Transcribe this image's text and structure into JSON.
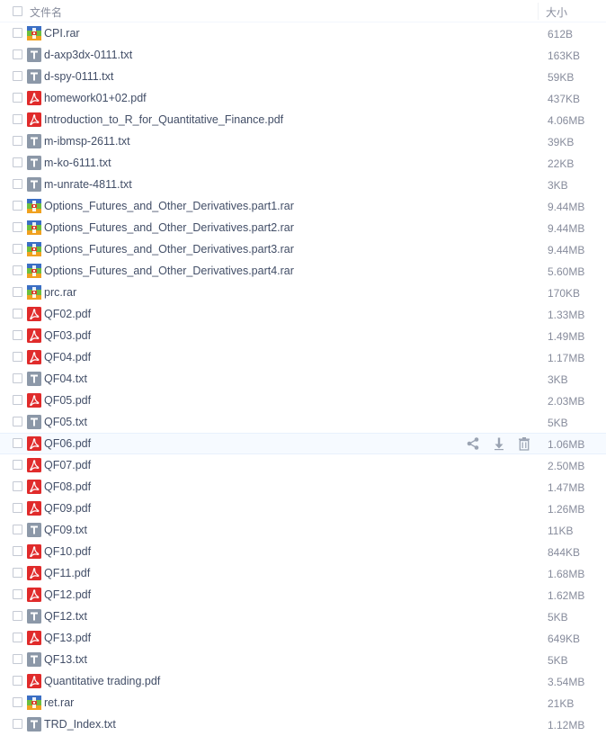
{
  "header": {
    "name_label": "文件名",
    "size_label": "大小"
  },
  "colors": {
    "text": "#424e67",
    "muted": "#878c9c",
    "hover_row": "#f6faff",
    "pdf_red": "#e02b2b",
    "txt_gray": "#8c98a8",
    "rar_blue": "#3b6fc4",
    "rar_green": "#6cbf3e",
    "rar_orange": "#f0a11f",
    "action_icon": "#9aa3b2"
  },
  "hover_index": 19,
  "hover_actions": [
    "share-icon",
    "download-icon",
    "delete-icon"
  ],
  "files": [
    {
      "name": "CPI.rar",
      "size": "612B",
      "type": "rar"
    },
    {
      "name": "d-axp3dx-0111.txt",
      "size": "163KB",
      "type": "txt"
    },
    {
      "name": "d-spy-0111.txt",
      "size": "59KB",
      "type": "txt"
    },
    {
      "name": "homework01+02.pdf",
      "size": "437KB",
      "type": "pdf"
    },
    {
      "name": "Introduction_to_R_for_Quantitative_Finance.pdf",
      "size": "4.06MB",
      "type": "pdf"
    },
    {
      "name": "m-ibmsp-2611.txt",
      "size": "39KB",
      "type": "txt"
    },
    {
      "name": "m-ko-6111.txt",
      "size": "22KB",
      "type": "txt"
    },
    {
      "name": "m-unrate-4811.txt",
      "size": "3KB",
      "type": "txt"
    },
    {
      "name": "Options_Futures_and_Other_Derivatives.part1.rar",
      "size": "9.44MB",
      "type": "rar"
    },
    {
      "name": "Options_Futures_and_Other_Derivatives.part2.rar",
      "size": "9.44MB",
      "type": "rar"
    },
    {
      "name": "Options_Futures_and_Other_Derivatives.part3.rar",
      "size": "9.44MB",
      "type": "rar"
    },
    {
      "name": "Options_Futures_and_Other_Derivatives.part4.rar",
      "size": "5.60MB",
      "type": "rar"
    },
    {
      "name": "prc.rar",
      "size": "170KB",
      "type": "rar"
    },
    {
      "name": "QF02.pdf",
      "size": "1.33MB",
      "type": "pdf"
    },
    {
      "name": "QF03.pdf",
      "size": "1.49MB",
      "type": "pdf"
    },
    {
      "name": "QF04.pdf",
      "size": "1.17MB",
      "type": "pdf"
    },
    {
      "name": "QF04.txt",
      "size": "3KB",
      "type": "txt"
    },
    {
      "name": "QF05.pdf",
      "size": "2.03MB",
      "type": "pdf"
    },
    {
      "name": "QF05.txt",
      "size": "5KB",
      "type": "txt"
    },
    {
      "name": "QF06.pdf",
      "size": "1.06MB",
      "type": "pdf"
    },
    {
      "name": "QF07.pdf",
      "size": "2.50MB",
      "type": "pdf"
    },
    {
      "name": "QF08.pdf",
      "size": "1.47MB",
      "type": "pdf"
    },
    {
      "name": "QF09.pdf",
      "size": "1.26MB",
      "type": "pdf"
    },
    {
      "name": "QF09.txt",
      "size": "11KB",
      "type": "txt"
    },
    {
      "name": "QF10.pdf",
      "size": "844KB",
      "type": "pdf"
    },
    {
      "name": "QF11.pdf",
      "size": "1.68MB",
      "type": "pdf"
    },
    {
      "name": "QF12.pdf",
      "size": "1.62MB",
      "type": "pdf"
    },
    {
      "name": "QF12.txt",
      "size": "5KB",
      "type": "txt"
    },
    {
      "name": "QF13.pdf",
      "size": "649KB",
      "type": "pdf"
    },
    {
      "name": "QF13.txt",
      "size": "5KB",
      "type": "txt"
    },
    {
      "name": "Quantitative trading.pdf",
      "size": "3.54MB",
      "type": "pdf"
    },
    {
      "name": "ret.rar",
      "size": "21KB",
      "type": "rar"
    },
    {
      "name": "TRD_Index.txt",
      "size": "1.12MB",
      "type": "txt"
    }
  ]
}
